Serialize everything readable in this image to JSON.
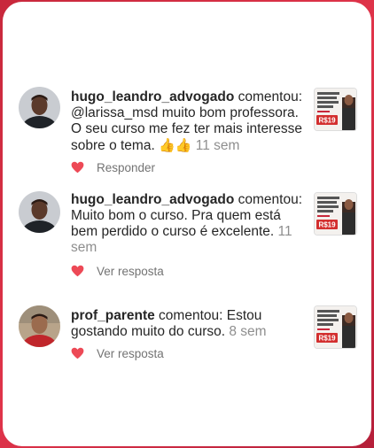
{
  "comments": [
    {
      "username": "hugo_leandro_advogado",
      "verb": " comentou: ",
      "body": "@larissa_msd muito bom professora. O seu curso me fez ter mais interesse sobre o tema. ",
      "emoji": "👍👍",
      "time": "11 sem",
      "action": "Responder"
    },
    {
      "username": "hugo_leandro_advogado",
      "verb": " comentou: ",
      "body": "Muito bom o curso. Pra quem está bem perdido o curso é excelente. ",
      "time": "11 sem",
      "action": "Ver resposta"
    },
    {
      "username": "prof_parente",
      "verb": " comentou: ",
      "body": "Estou gostando muito do curso. ",
      "time": "8 sem",
      "action": "Ver resposta"
    }
  ],
  "post_thumbnail": {
    "price": "R$19"
  },
  "colors": {
    "heart": "#ed4956",
    "frame": "#d42e45"
  }
}
